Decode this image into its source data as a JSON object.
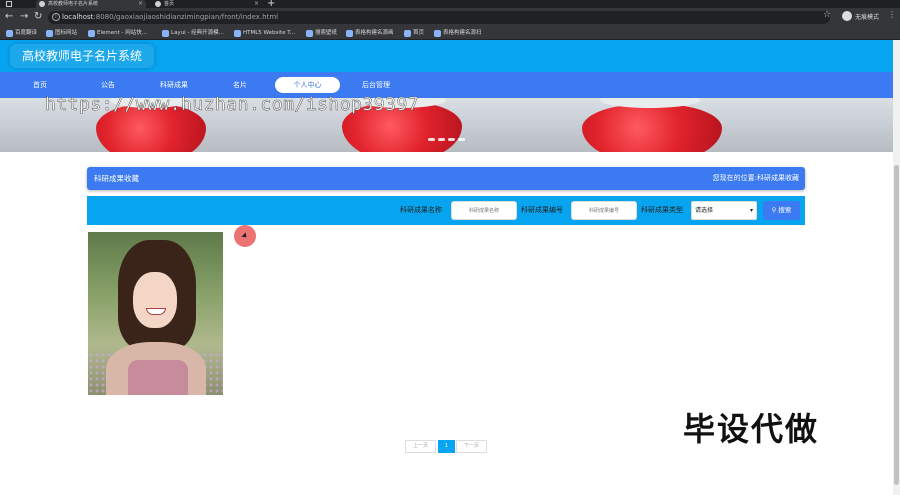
{
  "browser": {
    "tabs": [
      {
        "label": "高校教师电子名片系统",
        "active": true
      },
      {
        "label": "首页",
        "active": false
      }
    ],
    "url_host": "localhost",
    "url_path": ":8080/gaoxiaojiaoshidianzimingpian/front/index.html",
    "profile_label": "无痕模式",
    "bookmarks": [
      "百度翻译",
      "图标网站",
      "Element - 网站快...",
      "Layui - 经典开源模...",
      "HTML5 Website T...",
      "搜索壁纸",
      "表格构建名源画",
      "首页",
      "表格构建名源扫"
    ]
  },
  "site": {
    "title": "高校教师电子名片系统",
    "nav": [
      {
        "label": "首页",
        "active": false
      },
      {
        "label": "公告",
        "active": false
      },
      {
        "label": "科研成果",
        "active": false
      },
      {
        "label": "名片",
        "active": false
      },
      {
        "label": "个人中心",
        "active": true
      },
      {
        "label": "后台管理",
        "active": false
      }
    ]
  },
  "banner": {
    "watermark": "https://www.huzhan.com/ishop39397"
  },
  "breadcrumb": {
    "title": "科研成果收藏",
    "location_prefix": "您现在的位置:",
    "location_value": "科研成果收藏"
  },
  "search": {
    "name_label": "科研成果名称",
    "name_placeholder": "科研成果名称",
    "code_label": "科研成果编号",
    "code_placeholder": "科研成果编号",
    "type_label": "科研成果类型",
    "type_selected": "请选择",
    "button_label": "搜索"
  },
  "pagination": {
    "prev": "上一页",
    "current": "1",
    "next": "下一页"
  },
  "overlay": {
    "text": "毕设代做"
  },
  "colors": {
    "header_bg": "#07a5f0",
    "nav_bg": "#3b7af0",
    "accent": "#3b7af0"
  }
}
